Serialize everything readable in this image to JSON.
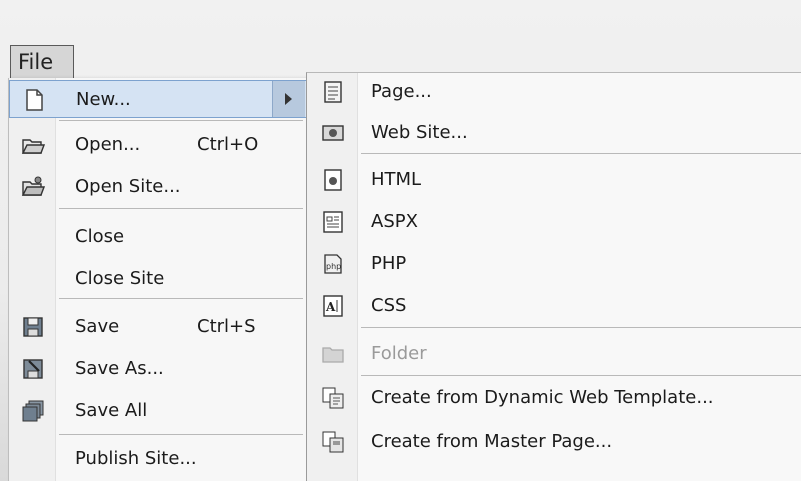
{
  "menubar": {
    "file_label": "File"
  },
  "file_menu": {
    "items": [
      {
        "label": "New...",
        "shortcut": "",
        "icon": "new-document-icon"
      },
      {
        "label": "Open...",
        "shortcut": "Ctrl+O",
        "icon": "open-folder-icon"
      },
      {
        "label": "Open Site...",
        "shortcut": "",
        "icon": "open-site-icon"
      },
      {
        "label": "Close",
        "shortcut": "",
        "icon": ""
      },
      {
        "label": "Close Site",
        "shortcut": "",
        "icon": ""
      },
      {
        "label": "Save",
        "shortcut": "Ctrl+S",
        "icon": "save-icon"
      },
      {
        "label": "Save As...",
        "shortcut": "",
        "icon": "save-as-icon"
      },
      {
        "label": "Save All",
        "shortcut": "",
        "icon": "save-all-icon"
      },
      {
        "label": "Publish Site...",
        "shortcut": "",
        "icon": ""
      }
    ]
  },
  "new_submenu": {
    "items": [
      {
        "label": "Page...",
        "icon": "page-icon",
        "enabled": true
      },
      {
        "label": "Web Site...",
        "icon": "web-site-icon",
        "enabled": true
      },
      {
        "label": "HTML",
        "icon": "html-icon",
        "enabled": true
      },
      {
        "label": "ASPX",
        "icon": "aspx-icon",
        "enabled": true
      },
      {
        "label": "PHP",
        "icon": "php-icon",
        "enabled": true
      },
      {
        "label": "CSS",
        "icon": "css-icon",
        "enabled": true
      },
      {
        "label": "Folder",
        "icon": "folder-icon",
        "enabled": false
      },
      {
        "label": "Create from Dynamic Web Template...",
        "icon": "dynamic-template-icon",
        "enabled": true
      },
      {
        "label": "Create from Master Page...",
        "icon": "master-page-icon",
        "enabled": true
      }
    ]
  },
  "colors": {
    "highlight": "#d5e3f3",
    "highlight_border": "#7da2ce",
    "disabled_text": "#9a9a9a"
  }
}
